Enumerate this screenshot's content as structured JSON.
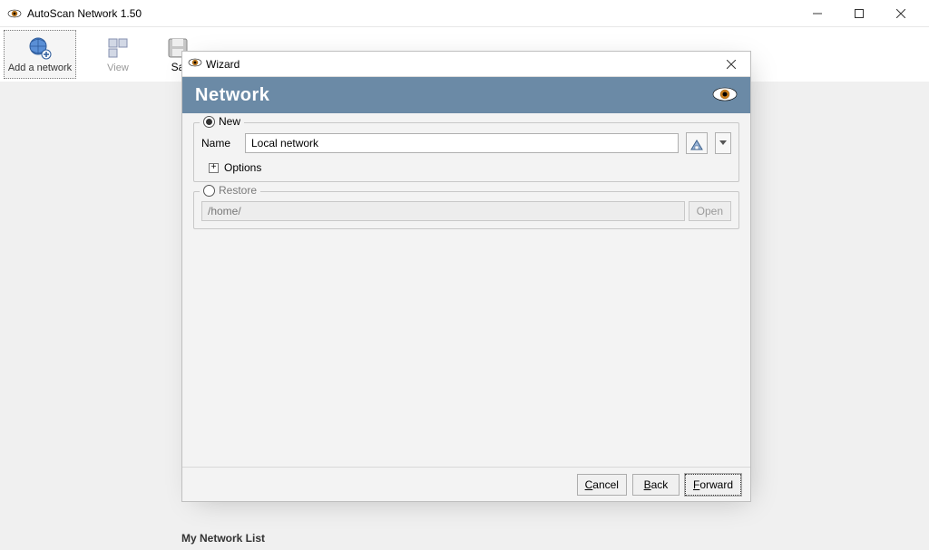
{
  "main_window": {
    "title": "AutoScan Network 1.50",
    "toolbar": {
      "add_network": "Add a network",
      "view": "View",
      "save_partial": "Sa"
    },
    "network_list_label": "My Network List"
  },
  "wizard": {
    "title": "Wizard",
    "heading": "Network",
    "new_group": {
      "legend": "New",
      "name_label": "Name",
      "name_value": "Local network",
      "options_label": "Options"
    },
    "restore_group": {
      "legend": "Restore",
      "path_value": "/home/",
      "open_label": "Open"
    },
    "buttons": {
      "cancel": "Cancel",
      "back": "Back",
      "forward": "Forward"
    }
  }
}
